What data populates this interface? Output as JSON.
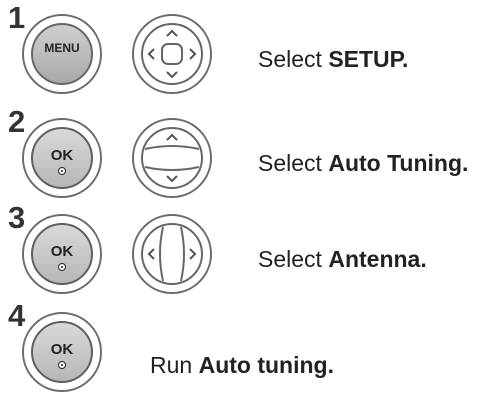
{
  "steps": [
    {
      "number": "1",
      "button_label": "MENU",
      "desc_prefix": "Select ",
      "desc_bold": "SETUP."
    },
    {
      "number": "2",
      "button_label": "OK",
      "desc_prefix": "Select ",
      "desc_bold": "Auto Tuning."
    },
    {
      "number": "3",
      "button_label": "OK",
      "desc_prefix": "Select ",
      "desc_bold": "Antenna."
    },
    {
      "number": "4",
      "button_label": "OK",
      "desc_prefix": "Run ",
      "desc_bold": "Auto tuning."
    }
  ],
  "colors": {
    "button_border": "#6d6d6d",
    "button_fill": "#bdbdbd",
    "text": "#222222"
  }
}
